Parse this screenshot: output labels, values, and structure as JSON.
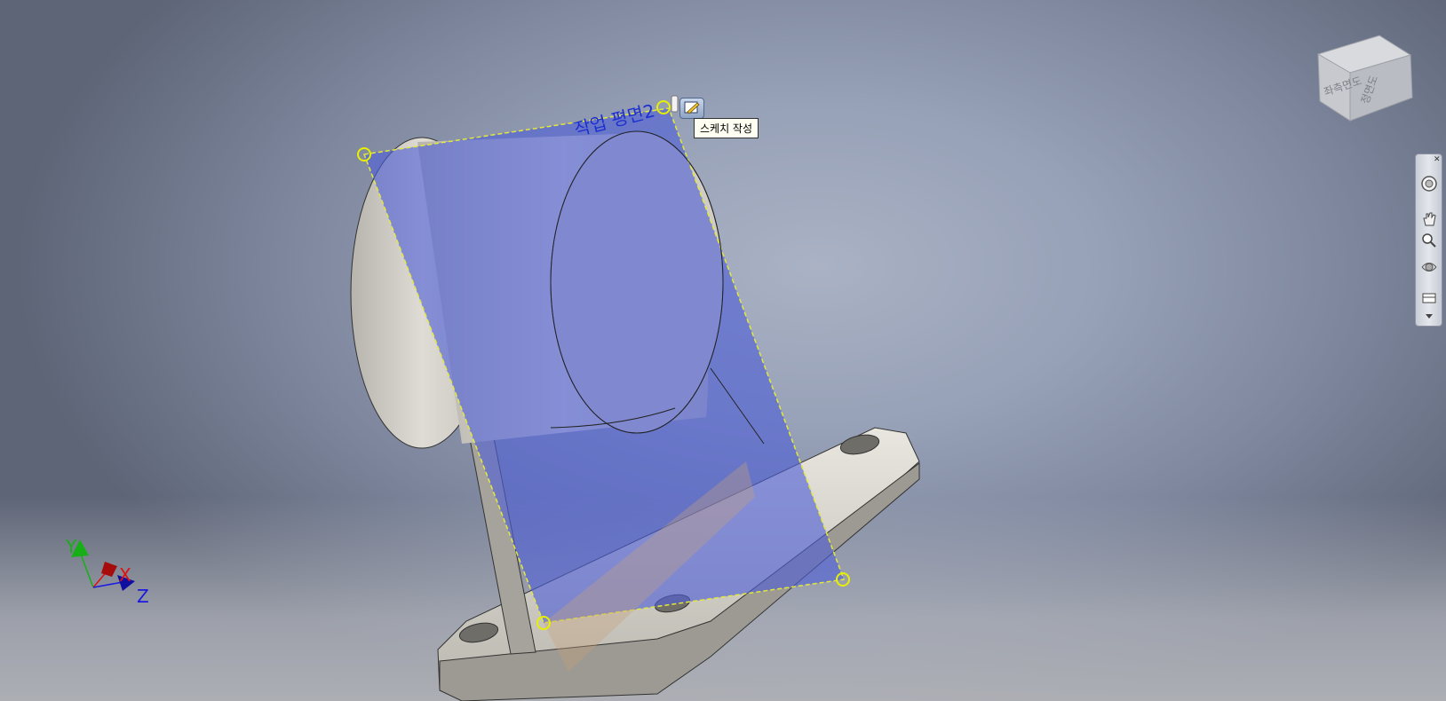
{
  "workplane": {
    "label": "작업 평면2"
  },
  "tooltip": {
    "text": "스케치 작성"
  },
  "viewcube": {
    "left_face": "좌측면도",
    "front_face": "정면도"
  },
  "axes": {
    "x": "X",
    "y": "Y",
    "z": "Z"
  },
  "colors": {
    "workplane_fill": "#4f5fd6",
    "workplane_label": "#1e2fd0",
    "x_axis": "#e01010",
    "y_axis": "#16b016",
    "z_axis": "#1a1ae0"
  },
  "navbar": {
    "items": [
      "steering-wheel-icon",
      "pan-icon",
      "zoom-icon",
      "orbit-icon",
      "look-at-icon",
      "customize-icon"
    ]
  }
}
